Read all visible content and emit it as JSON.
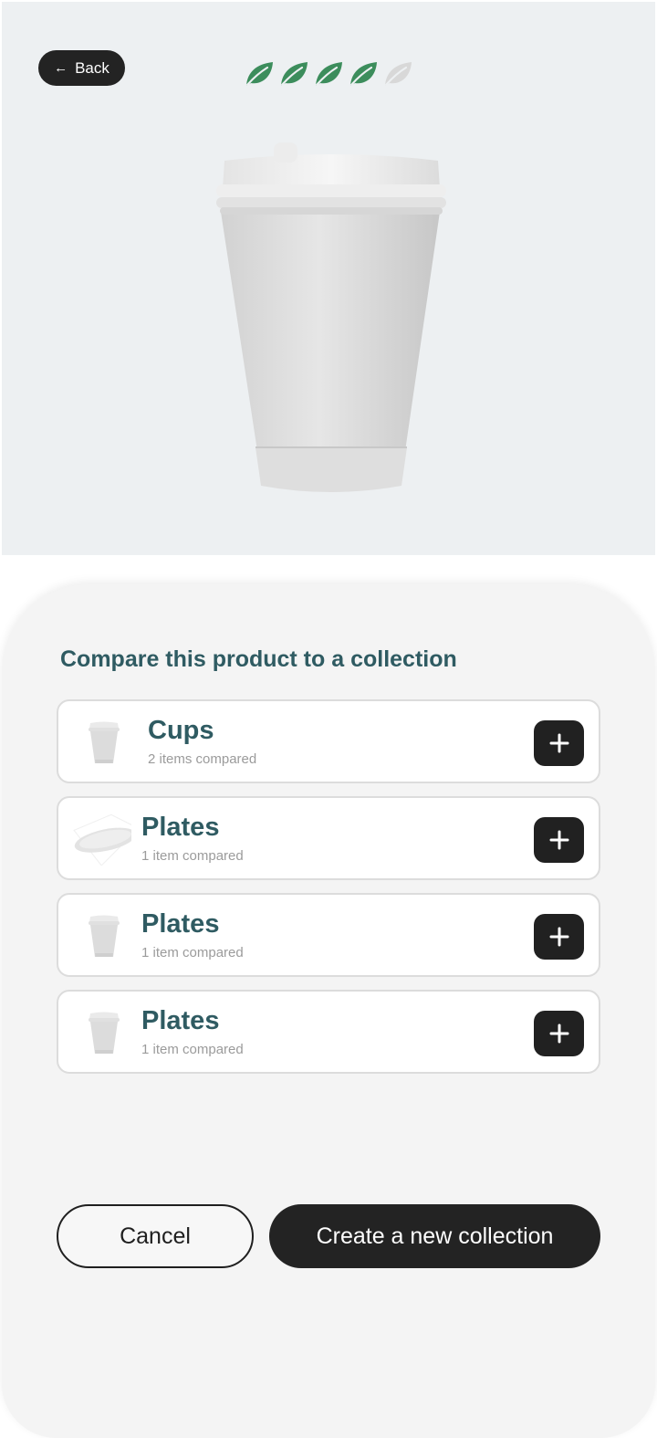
{
  "header": {
    "back_label": "Back",
    "rating": {
      "value": 4,
      "max": 5
    }
  },
  "colors": {
    "accent_text": "#2f5b62",
    "leaf_on": "#3c8d5c",
    "leaf_off": "#d8d8d8",
    "dark_button": "#232323"
  },
  "sheet": {
    "title": "Compare this product to a collection",
    "collections": [
      {
        "name": "Cups",
        "count": "2 items compared",
        "thumb": "cup-icon"
      },
      {
        "name": "Plates",
        "count": "1 item compared",
        "thumb": "plate-icon"
      },
      {
        "name": "Plates",
        "count": "1 item compared",
        "thumb": "cup-icon"
      },
      {
        "name": "Plates",
        "count": "1 item compared",
        "thumb": "cup-icon"
      }
    ],
    "cancel_label": "Cancel",
    "create_label": "Create a new collection"
  }
}
